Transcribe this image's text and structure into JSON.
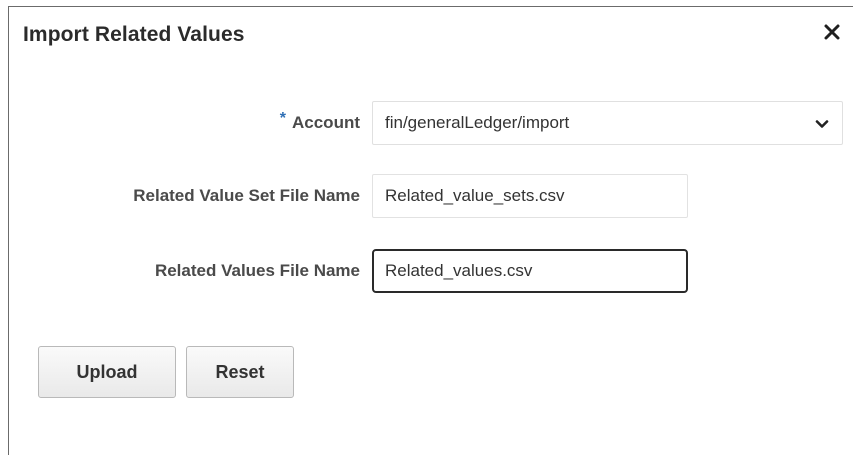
{
  "dialog": {
    "title": "Import Related Values",
    "close_icon": "close-icon"
  },
  "form": {
    "account": {
      "required_marker": "*",
      "label": "Account",
      "value": "fin/generalLedger/import",
      "icon": "chevron-down-icon"
    },
    "related_value_set_file": {
      "label": "Related Value Set File Name",
      "value": "Related_value_sets.csv"
    },
    "related_values_file": {
      "label": "Related Values File Name",
      "value": "Related_values.csv"
    }
  },
  "buttons": {
    "upload_label": "Upload",
    "reset_label": "Reset"
  },
  "colors": {
    "required_marker": "#2f6fb5",
    "focused_border": "#2a2a2a",
    "label_text": "#4a4a4a"
  }
}
